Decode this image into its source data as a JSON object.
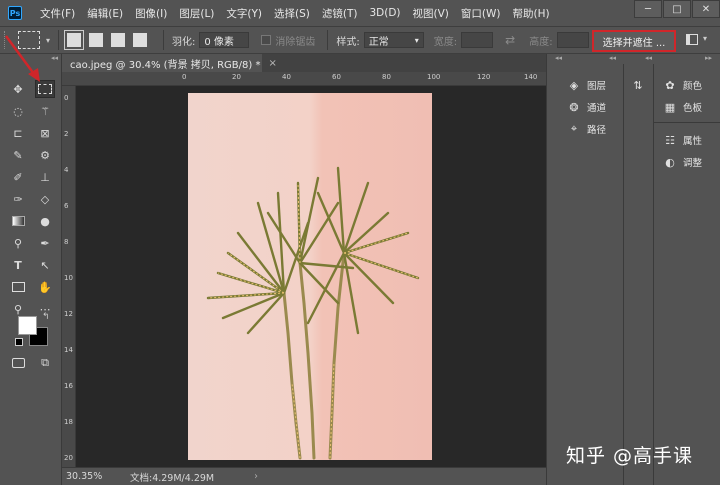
{
  "app": {
    "logo": "Ps"
  },
  "menu": [
    "文件(F)",
    "编辑(E)",
    "图像(I)",
    "图层(L)",
    "文字(Y)",
    "选择(S)",
    "滤镜(T)",
    "3D(D)",
    "视图(V)",
    "窗口(W)",
    "帮助(H)"
  ],
  "window_controls": {
    "minimize": "─",
    "maximize": "□",
    "close": "✕"
  },
  "options": {
    "feather_label": "羽化:",
    "feather_value": "0 像素",
    "antialias_label": "消除锯齿",
    "style_label": "样式:",
    "style_value": "正常",
    "width_label": "宽度:",
    "height_label": "高度:",
    "swap_icon": "⇄",
    "select_and_mask": "选择并遮住 ..."
  },
  "document": {
    "tab_title": "cao.jpeg @ 30.4% (背景 拷贝, RGB/8) *",
    "close": "×"
  },
  "rulers": {
    "h_ticks": [
      "0",
      "20",
      "40",
      "60",
      "80",
      "100",
      "120",
      "140"
    ],
    "v_ticks": [
      "0",
      "2",
      "4",
      "6",
      "8",
      "10",
      "12",
      "14",
      "16",
      "18",
      "20"
    ]
  },
  "status": {
    "zoom": "30.35%",
    "doc_info": "文档:4.29M/4.29M",
    "arrow": "›"
  },
  "panels": {
    "dock1": [
      {
        "label": "图层",
        "icon": "layers-icon"
      },
      {
        "label": "通道",
        "icon": "channels-icon"
      },
      {
        "label": "路径",
        "icon": "paths-icon"
      }
    ],
    "dock3_top": [
      {
        "label": "颜色",
        "icon": "palette-icon"
      },
      {
        "label": "色板",
        "icon": "swatches-icon"
      }
    ],
    "dock3_bottom": [
      {
        "label": "属性",
        "icon": "properties-icon"
      },
      {
        "label": "调整",
        "icon": "adjustments-icon"
      }
    ]
  },
  "tools": [
    "move-tool",
    "marquee-tool",
    "lasso-tool",
    "magic-wand-tool",
    "crop-tool",
    "frame-tool",
    "eyedropper-tool",
    "healing-brush-tool",
    "brush-tool",
    "clone-stamp-tool",
    "history-brush-tool",
    "eraser-tool",
    "gradient-tool",
    "blur-tool",
    "dodge-tool",
    "pen-tool",
    "type-tool",
    "path-selection-tool",
    "rectangle-tool",
    "hand-tool",
    "zoom-tool",
    "more-tools"
  ],
  "colors": {
    "foreground": "#ffffff",
    "background": "#000000",
    "highlight": "#d0262a"
  },
  "watermark": "知乎 @高手课"
}
